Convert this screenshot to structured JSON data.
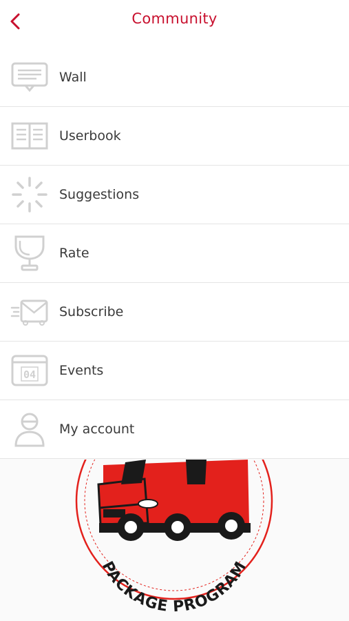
{
  "header": {
    "title": "Community",
    "accent_color": "#c8102e",
    "back_icon": "chevron-left-icon"
  },
  "menu": {
    "items": [
      {
        "label": "Wall",
        "icon": "message-board-icon"
      },
      {
        "label": "Userbook",
        "icon": "open-book-icon"
      },
      {
        "label": "Suggestions",
        "icon": "loading-spinner-icon"
      },
      {
        "label": "Rate",
        "icon": "trophy-icon"
      },
      {
        "label": "Subscribe",
        "icon": "fast-envelope-icon"
      },
      {
        "label": "Events",
        "icon": "calendar-icon"
      },
      {
        "label": "My account",
        "icon": "user-icon"
      }
    ],
    "icon_color": "#d0d0d0"
  },
  "logo": {
    "text": "PACKAGE PROGRAM",
    "colors": {
      "red": "#e3211c",
      "dark": "#1a1a1a"
    }
  }
}
